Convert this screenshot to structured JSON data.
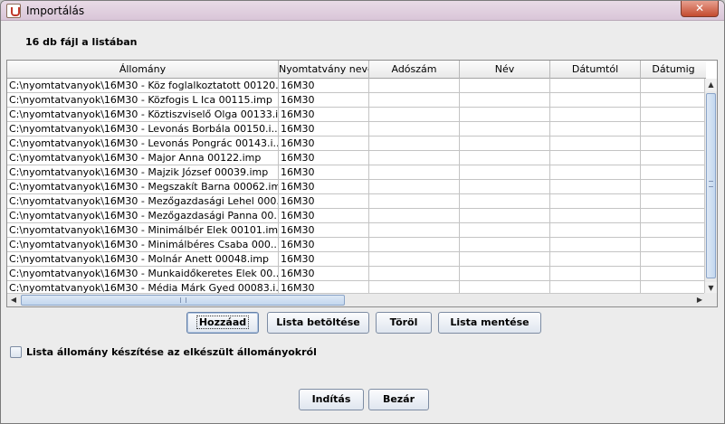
{
  "window": {
    "title": "Importálás",
    "close_label": "✕"
  },
  "file_count_label": "16 db fájl a listában",
  "table": {
    "columns": [
      "Állomány",
      "Nyomtatvány neve",
      "Adószám",
      "Név",
      "Dátumtól",
      "Dátumig"
    ],
    "rows": [
      [
        "C:\\nyomtatvanyok\\16M30 - Köz foglalkoztatott 00120.i...",
        "16M30",
        "",
        "",
        "",
        ""
      ],
      [
        "C:\\nyomtatvanyok\\16M30 - Közfogis L Ica 00115.imp",
        "16M30",
        "",
        "",
        "",
        ""
      ],
      [
        "C:\\nyomtatvanyok\\16M30 - Köztiszviselő Olga 00133.i...",
        "16M30",
        "",
        "",
        "",
        ""
      ],
      [
        "C:\\nyomtatvanyok\\16M30 - Levonás Borbála 00150.i...",
        "16M30",
        "",
        "",
        "",
        ""
      ],
      [
        "C:\\nyomtatvanyok\\16M30 - Levonás Pongrác 00143.i...",
        "16M30",
        "",
        "",
        "",
        ""
      ],
      [
        "C:\\nyomtatvanyok\\16M30 - Major Anna 00122.imp",
        "16M30",
        "",
        "",
        "",
        ""
      ],
      [
        "C:\\nyomtatvanyok\\16M30 - Majzik József 00039.imp",
        "16M30",
        "",
        "",
        "",
        ""
      ],
      [
        "C:\\nyomtatvanyok\\16M30 - Megszakít Barna 00062.imp",
        "16M30",
        "",
        "",
        "",
        ""
      ],
      [
        "C:\\nyomtatvanyok\\16M30 - Mezőgazdasági Lehel 000...",
        "16M30",
        "",
        "",
        "",
        ""
      ],
      [
        "C:\\nyomtatvanyok\\16M30 - Mezőgazdasági Panna 00...",
        "16M30",
        "",
        "",
        "",
        ""
      ],
      [
        "C:\\nyomtatvanyok\\16M30 - Minimálbér Elek 00101.imp",
        "16M30",
        "",
        "",
        "",
        ""
      ],
      [
        "C:\\nyomtatvanyok\\16M30 - Minimálbéres Csaba 000...",
        "16M30",
        "",
        "",
        "",
        ""
      ],
      [
        "C:\\nyomtatvanyok\\16M30 - Molnár Anett 00048.imp",
        "16M30",
        "",
        "",
        "",
        ""
      ],
      [
        "C:\\nyomtatvanyok\\16M30 - Munkaidőkeretes Elek 00...",
        "16M30",
        "",
        "",
        "",
        ""
      ],
      [
        "C:\\nyomtatvanyok\\16M30 - Média Márk Gyed 00083.i...",
        "16M30",
        "",
        "",
        "",
        ""
      ]
    ]
  },
  "scroll": {
    "up": "▲",
    "down": "▼",
    "left": "◀",
    "right": "▶"
  },
  "buttons": {
    "add": "Hozzáad",
    "load_list": "Lista betöltése",
    "delete": "Töröl",
    "save_list": "Lista mentése",
    "start": "Indítás",
    "close": "Bezár"
  },
  "checkbox": {
    "label": "Lista állomány készítése az elkészült állományokról",
    "checked": false
  }
}
